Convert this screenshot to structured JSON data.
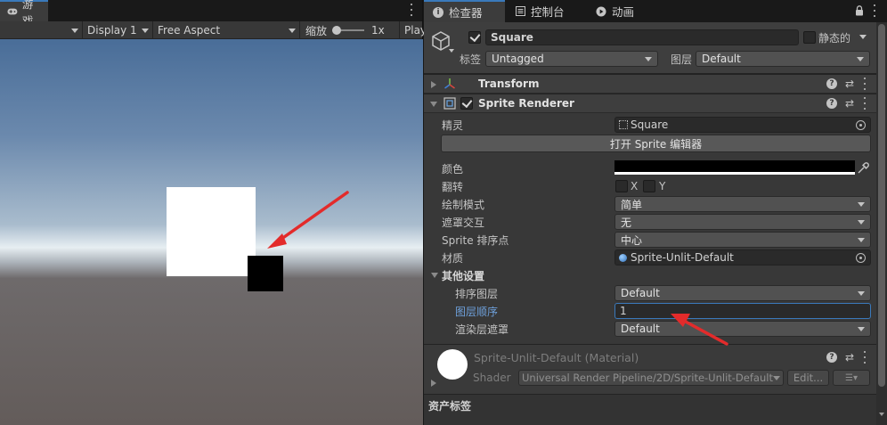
{
  "game": {
    "tab_label": "游戏",
    "toolbar": {
      "display": "Display 1",
      "aspect": "Free Aspect",
      "scale_label": "缩放",
      "scale_value": "1x",
      "play_label": "Play"
    }
  },
  "inspector": {
    "tabs": [
      {
        "label": "检查器",
        "icon": "info-icon"
      },
      {
        "label": "控制台",
        "icon": "console-icon"
      },
      {
        "label": "动画",
        "icon": "animation-icon"
      }
    ],
    "object": {
      "name": "Square",
      "static_label": "静态的",
      "tag_label": "标签",
      "tag_value": "Untagged",
      "layer_label": "图层",
      "layer_value": "Default"
    },
    "transform": {
      "title": "Transform"
    },
    "sprite_renderer": {
      "title": "Sprite Renderer",
      "sprite_label": "精灵",
      "sprite_value": "Square",
      "open_editor": "打开 Sprite 编辑器",
      "color_label": "颜色",
      "color_value": "#000000",
      "flip_label": "翻转",
      "flip_x": "X",
      "flip_y": "Y",
      "draw_mode_label": "绘制模式",
      "draw_mode_value": "简单",
      "mask_label": "遮罩交互",
      "mask_value": "无",
      "sort_point_label": "Sprite 排序点",
      "sort_point_value": "中心",
      "material_label": "材质",
      "material_value": "Sprite-Unlit-Default",
      "additional_label": "其他设置",
      "sorting_layer_label": "排序图层",
      "sorting_layer_value": "Default",
      "order_label": "图层顺序",
      "order_value": "1",
      "rendering_layer_label": "渲染层遮罩",
      "rendering_layer_value": "Default"
    },
    "material": {
      "title": "Sprite-Unlit-Default (Material)",
      "shader_label": "Shader",
      "shader_value": "Universal Render Pipeline/2D/Sprite-Unlit-Default",
      "edit_label": "Edit..."
    },
    "asset_labels": "资产标签"
  },
  "colors": {
    "accent": "#3a79bb",
    "arrow": "#e32b2b",
    "highlight_label": "#6ea0db"
  }
}
